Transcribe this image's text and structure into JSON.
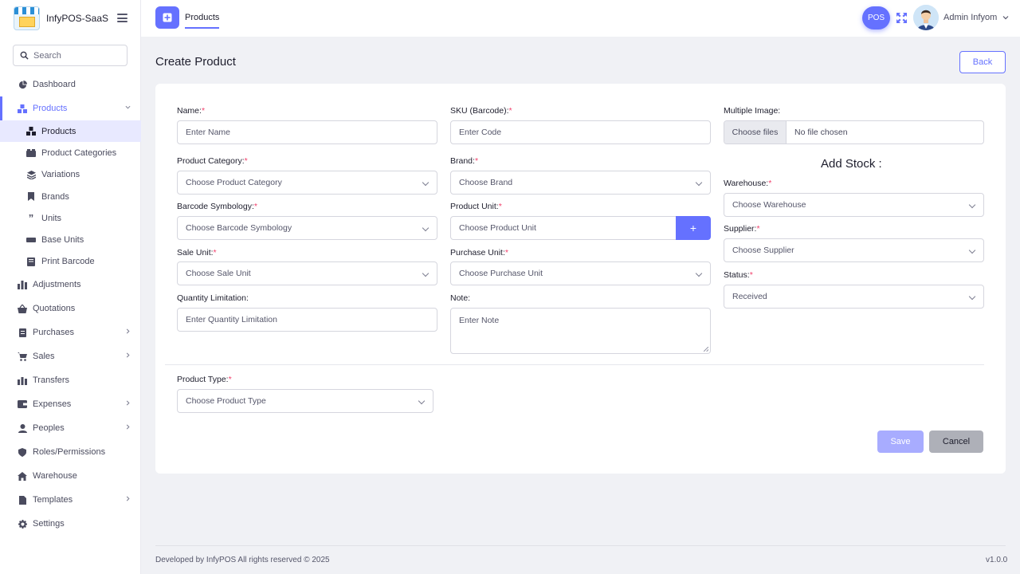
{
  "app": {
    "name": "InfyPOS-SaaS"
  },
  "search": {
    "placeholder": "Search"
  },
  "sidebar": {
    "items": [
      {
        "label": "Dashboard",
        "icon": "dashboard-icon"
      },
      {
        "label": "Products",
        "icon": "products-icon",
        "expanded": true,
        "children": [
          {
            "label": "Products",
            "icon": "products-icon",
            "selected": true
          },
          {
            "label": "Product Categories",
            "icon": "categories-icon"
          },
          {
            "label": "Variations",
            "icon": "variations-icon"
          },
          {
            "label": "Brands",
            "icon": "bookmark-icon"
          },
          {
            "label": "Units",
            "icon": "quote-icon"
          },
          {
            "label": "Base Units",
            "icon": "base-units-icon"
          },
          {
            "label": "Print Barcode",
            "icon": "print-icon"
          }
        ]
      },
      {
        "label": "Adjustments",
        "icon": "adjustments-icon"
      },
      {
        "label": "Quotations",
        "icon": "basket-icon"
      },
      {
        "label": "Purchases",
        "icon": "receipt-icon",
        "has_children": true
      },
      {
        "label": "Sales",
        "icon": "cart-icon",
        "has_children": true
      },
      {
        "label": "Transfers",
        "icon": "transfer-icon"
      },
      {
        "label": "Expenses",
        "icon": "wallet-icon",
        "has_children": true
      },
      {
        "label": "Peoples",
        "icon": "user-icon",
        "has_children": true
      },
      {
        "label": "Roles/Permissions",
        "icon": "shield-icon"
      },
      {
        "label": "Warehouse",
        "icon": "home-icon"
      },
      {
        "label": "Templates",
        "icon": "file-icon",
        "has_children": true
      },
      {
        "label": "Settings",
        "icon": "gear-icon"
      }
    ]
  },
  "header": {
    "tab_label": "Products",
    "pos_label": "POS",
    "user_name": "Admin Infyom"
  },
  "page": {
    "title": "Create Product",
    "back_label": "Back"
  },
  "form": {
    "name": {
      "label": "Name:",
      "placeholder": "Enter Name"
    },
    "sku": {
      "label": "SKU (Barcode):",
      "placeholder": "Enter Code"
    },
    "images": {
      "label": "Multiple Image:",
      "button": "Choose files",
      "status": "No file chosen"
    },
    "category": {
      "label": "Product Category:",
      "placeholder": "Choose Product Category"
    },
    "brand": {
      "label": "Brand:",
      "placeholder": "Choose Brand"
    },
    "stock_heading": "Add Stock :",
    "warehouse": {
      "label": "Warehouse:",
      "placeholder": "Choose Warehouse"
    },
    "symbology": {
      "label": "Barcode Symbology:",
      "placeholder": "Choose Barcode Symbology"
    },
    "unit": {
      "label": "Product Unit:",
      "placeholder": "Choose Product Unit",
      "add_label": "+"
    },
    "supplier": {
      "label": "Supplier:",
      "placeholder": "Choose Supplier"
    },
    "sale_unit": {
      "label": "Sale Unit:",
      "placeholder": "Choose Sale Unit"
    },
    "purchase_unit": {
      "label": "Purchase Unit:",
      "placeholder": "Choose Purchase Unit"
    },
    "status": {
      "label": "Status:",
      "value": "Received"
    },
    "quantity_limit": {
      "label": "Quantity Limitation:",
      "placeholder": "Enter Quantity Limitation"
    },
    "note": {
      "label": "Note:",
      "placeholder": "Enter Note"
    },
    "product_type": {
      "label": "Product Type:",
      "placeholder": "Choose Product Type"
    },
    "save_label": "Save",
    "cancel_label": "Cancel",
    "required_mark": "*"
  },
  "footer": {
    "copyright": "Developed by InfyPOS All rights reserved © 2025",
    "version": "v1.0.0"
  },
  "colors": {
    "accent": "#6571ff",
    "required": "#f1416c",
    "save_disabled": "#a8acff",
    "cancel": "#aeb0b8"
  }
}
